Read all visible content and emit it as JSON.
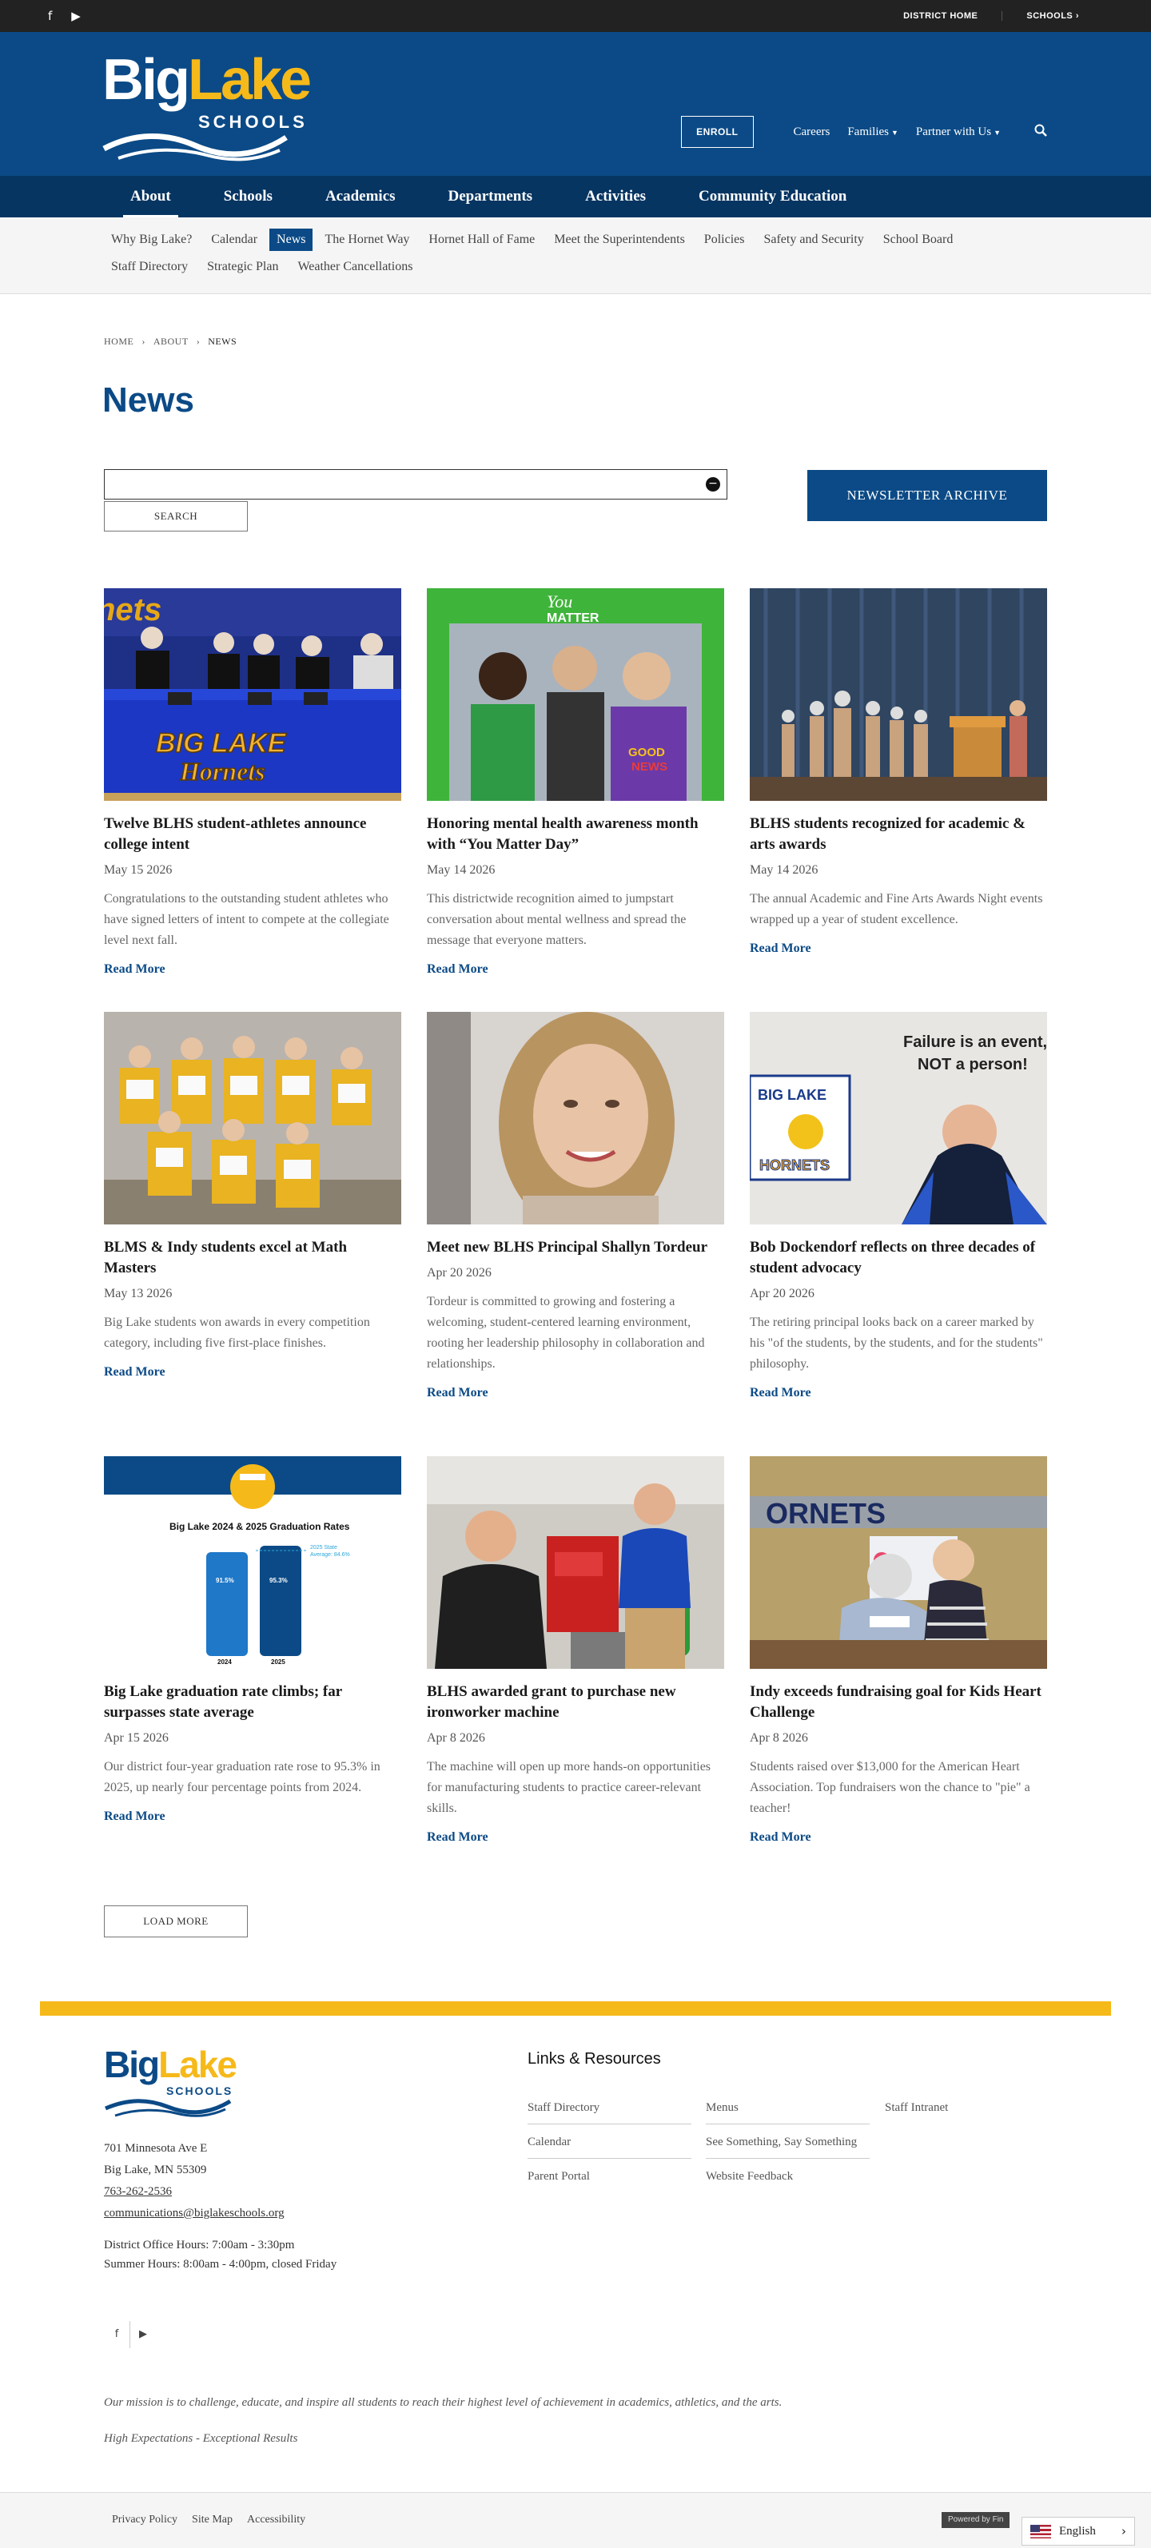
{
  "topbar": {
    "facebook_icon": "facebook-icon",
    "youtube_icon": "youtube-icon",
    "district_home": "DISTRICT HOME",
    "schools": "SCHOOLS"
  },
  "brand": {
    "logo_big": "Big",
    "logo_lake": "Lake",
    "logo_schools": "SCHOOLS",
    "primary_color": "#0b4a86",
    "accent_color": "#f6b91a"
  },
  "header_nav": {
    "enroll": "ENROLL",
    "careers": "Careers",
    "families": "Families",
    "partner": "Partner with Us"
  },
  "main_nav": [
    "About",
    "Schools",
    "Academics",
    "Departments",
    "Activities",
    "Community Education"
  ],
  "sub_nav": [
    "Why Big Lake?",
    "Calendar",
    "News",
    "The Hornet Way",
    "Hornet Hall of Fame",
    "Meet the Superintendents",
    "Policies",
    "Safety and Security",
    "School Board",
    "Staff Directory",
    "Strategic Plan",
    "Weather Cancellations"
  ],
  "breadcrumb": {
    "home": "HOME",
    "about": "ABOUT",
    "current": "NEWS"
  },
  "page_title": "News",
  "search": {
    "value": "",
    "button": "SEARCH"
  },
  "newsletter_archive": "NEWSLETTER ARCHIVE",
  "articles": [
    {
      "title": "Twelve BLHS student-athletes announce college intent",
      "date": "May 15 2026",
      "summary": "Congratulations to the outstanding student athletes who have signed letters of intent to compete at the collegiate level next fall.",
      "more": "Read More"
    },
    {
      "title": "Honoring mental health awareness month with “You Matter Day”",
      "date": "May 14 2026",
      "summary": "This districtwide recognition aimed to jumpstart conversation about mental wellness and spread the message that everyone matters.",
      "more": "Read More"
    },
    {
      "title": "BLHS students recognized for academic & arts awards",
      "date": "May 14 2026",
      "summary": "The annual Academic and Fine Arts Awards Night events wrapped up a year of student excellence.",
      "more": "Read More"
    },
    {
      "title": "BLMS & Indy students excel at Math Masters",
      "date": "May 13 2026",
      "summary": "Big Lake students won awards in every competition category, including five first-place finishes.",
      "more": "Read More"
    },
    {
      "title": "Meet new BLHS Principal Shallyn Tordeur",
      "date": "Apr 20 2026",
      "summary": "Tordeur is committed to growing and fostering a welcoming, student-centered learning environment, rooting her leadership philosophy in collaboration and relationships.",
      "more": "Read More"
    },
    {
      "title": "Bob Dockendorf reflects on three decades of student advocacy",
      "date": "Apr 20 2026",
      "summary": "The retiring principal looks back on a career marked by his \"of the students, by the students, and for the students\" philosophy.",
      "more": "Read More"
    },
    {
      "title": "Big Lake graduation rate climbs; far surpasses state average",
      "date": "Apr 15 2026",
      "summary": "Our district four-year graduation rate rose to 95.3% in 2025, up nearly four percentage points from 2024.",
      "more": "Read More"
    },
    {
      "title": "BLHS awarded grant to purchase new ironworker machine",
      "date": "Apr 8 2026",
      "summary": "The machine will open up more hands-on opportunities for manufacturing students to practice career-relevant skills.",
      "more": "Read More"
    },
    {
      "title": "Indy exceeds fundraising goal for Kids Heart Challenge",
      "date": "Apr 8 2026",
      "summary": "Students raised over $13,000 for the American Heart Association. Top fundraisers won the chance to \"pie\" a teacher!",
      "more": "Read More"
    }
  ],
  "image_text": {
    "signing_banner": "BIG LAKE Hornets",
    "frame_text": "You MATTER",
    "shirt_text": "GOOD NEWS",
    "poster_line1": "Failure is an event,",
    "poster_line2": "NOT a person!",
    "hornets_sign": "BIG LAKE HORNETS",
    "grad_title": "Big Lake 2024 & 2025 Graduation Rates",
    "grad_bar1_val": "91.5%",
    "grad_bar2_val": "95.3%",
    "grad_bar1_year": "2024",
    "grad_bar2_year": "2025",
    "grad_state": "2025 State Average: 84.6%",
    "gym_banner": "ORNETS"
  },
  "load_more": "LOAD MORE",
  "footer": {
    "address1": "701 Minnesota Ave E",
    "address2": "Big Lake, MN  55309",
    "phone": "763-262-2536",
    "email": "communications@biglakeschools.org",
    "hours1": "District Office Hours: 7:00am - 3:30pm",
    "hours2": "Summer Hours: 8:00am - 4:00pm, closed Friday",
    "links_title": "Links & Resources",
    "links_col1": [
      "Staff Directory",
      "Calendar",
      "Parent Portal"
    ],
    "links_col2": [
      "Menus",
      "See Something, Say Something",
      "Website Feedback"
    ],
    "links_col3": [
      "Staff Intranet"
    ],
    "mission": "Our mission is to challenge, educate, and inspire all students to reach their highest level of achievement in academics, athletics, and the arts.",
    "tagline": "High Expectations - Exceptional Results",
    "bottom_links": [
      "Privacy Policy",
      "Site Map",
      "Accessibility"
    ],
    "powered": "Powered by Fin",
    "language": "English"
  }
}
